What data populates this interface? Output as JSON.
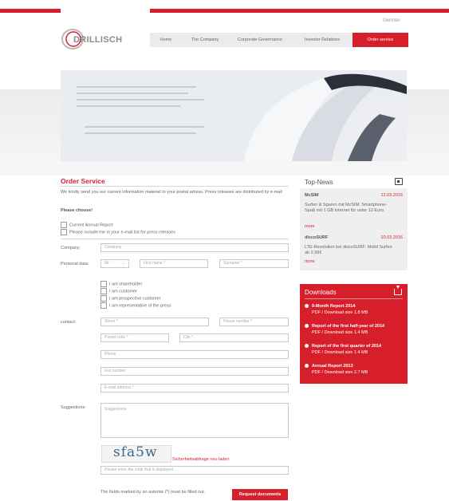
{
  "header": {
    "lang": "German",
    "logo_text": "DRILLISCH",
    "nav": [
      "Home",
      "The Company",
      "Corporate Governance",
      "Investor Relations",
      "Order service"
    ]
  },
  "form": {
    "title": "Order Service",
    "intro": "We kindly send you our current information material to your postal adress. Press releases are distributed by e-mail",
    "choose_label": "Please choose!",
    "opt_annual": "Current Annual Report",
    "opt_press": "Please include me in your e-mail list for press releases",
    "company_label": "Company:",
    "company_ph": "Company",
    "personal_label": "Personal data:",
    "salutation": "Mr",
    "firstname_ph": "First name *",
    "surname_ph": "Surname *",
    "roles": [
      "I am shareholder",
      "I am customer",
      "I am prospective customer",
      "I am representative of the press"
    ],
    "contact_label": "contact:",
    "street_ph": "Street *",
    "house_ph": "House number *",
    "postal_ph": "Postal code *",
    "city_ph": "City *",
    "phone_ph": "Phone",
    "fax_ph": "Fax number",
    "email_ph": "E-mail address *",
    "suggestions_label": "Suggestions:",
    "suggestions_ph": "Suggestions",
    "captcha_text": "sfa5w",
    "captcha_reload": "Sicherheitsabfrage neu laden",
    "captcha_ph": "Please enter the code that is displayed",
    "asterisk_note": "The fields marked by an asterisk (*) must be filled out.",
    "submit": "Request documents"
  },
  "topnews": {
    "title": "Top-News",
    "items": [
      {
        "name": "McSIM",
        "date": "12.03.2016",
        "text": "Surfen & Sparen mit McSIM: Smartphone-Spaß mit 1 GB Internet für unter 10 Euro",
        "more": "more"
      },
      {
        "name": "discoSURF",
        "date": "10.03.2016",
        "text": "LTE-Revolution bei discoSURF: Mobil Surfen ab 2,99€",
        "more": "more"
      }
    ]
  },
  "downloads": {
    "title": "Downloads",
    "items": [
      {
        "title": "9-Month Report 2014",
        "meta": "PDF / Download size 1.8 MB"
      },
      {
        "title": "Report of the first half-year of 2014",
        "meta": "PDF / Download size 1.4 MB"
      },
      {
        "title": "Report of the first quarter of 2014",
        "meta": "PDF / Download size 1.4 MB"
      },
      {
        "title": "Annual Report 2013",
        "meta": "PDF / Download size 2.7 MB"
      }
    ]
  }
}
